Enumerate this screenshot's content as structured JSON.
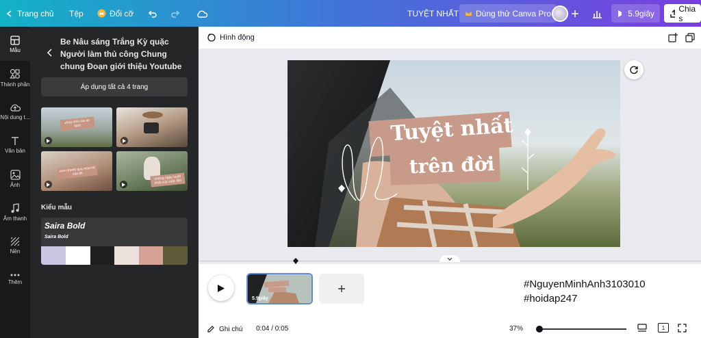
{
  "topbar": {
    "home": "Trang chủ",
    "file": "Tệp",
    "resize": "Đổi cỡ",
    "title": "TUYỆT NHẤT",
    "try_pro": "Dùng thử Canva Pro",
    "play_duration": "5.9giây",
    "share": "Chia s"
  },
  "rail": [
    {
      "label": "Mẫu",
      "icon": "template-icon"
    },
    {
      "label": "Thành phần",
      "icon": "elements-icon"
    },
    {
      "label": "Nội dung t...",
      "icon": "upload-icon"
    },
    {
      "label": "Văn bản",
      "icon": "text-icon"
    },
    {
      "label": "Ảnh",
      "icon": "image-icon"
    },
    {
      "label": "Âm thanh",
      "icon": "music-icon"
    },
    {
      "label": "Nền",
      "icon": "background-icon"
    },
    {
      "label": "Thêm",
      "icon": "more-icon"
    }
  ],
  "panel": {
    "template_title": "Be Nâu sáng Trắng Kỳ quặc Người làm thủ công Chung chung Đoạn giới thiệu Youtube",
    "apply_all": "Áp dụng tất cả 4 trang",
    "thumbs": [
      {
        "text": "vòng nhỏ của an lành"
      },
      {
        "text": ""
      },
      {
        "text": "xem nhanh qua mùa hè của tôi"
      },
      {
        "text": "những ngày tuyệt nhất của cuộc đời"
      }
    ],
    "styles_heading": "Kiểu mẫu",
    "style_font_heading": "Saira Bold",
    "style_font_sub": "Saira Bold",
    "swatches": [
      "#c9c6e2",
      "#ffffff",
      "#1e1e1e",
      "#ece0dc",
      "#d6a196",
      "#5f5a37"
    ]
  },
  "subbar": {
    "animate": "Hình động"
  },
  "canvas": {
    "title_line1": "Tuyệt nhất",
    "title_line2": "trên đời",
    "label_color": "#c89a8a"
  },
  "timeline": {
    "clip_duration": "5.9giây"
  },
  "overlay": {
    "line1": "#NguyenMinhAnh3103010",
    "line2": "#hoidap247"
  },
  "footer": {
    "notes": "Ghi chú",
    "time": "0:04 / 0:05",
    "zoom": "37%",
    "page_count": "1"
  }
}
